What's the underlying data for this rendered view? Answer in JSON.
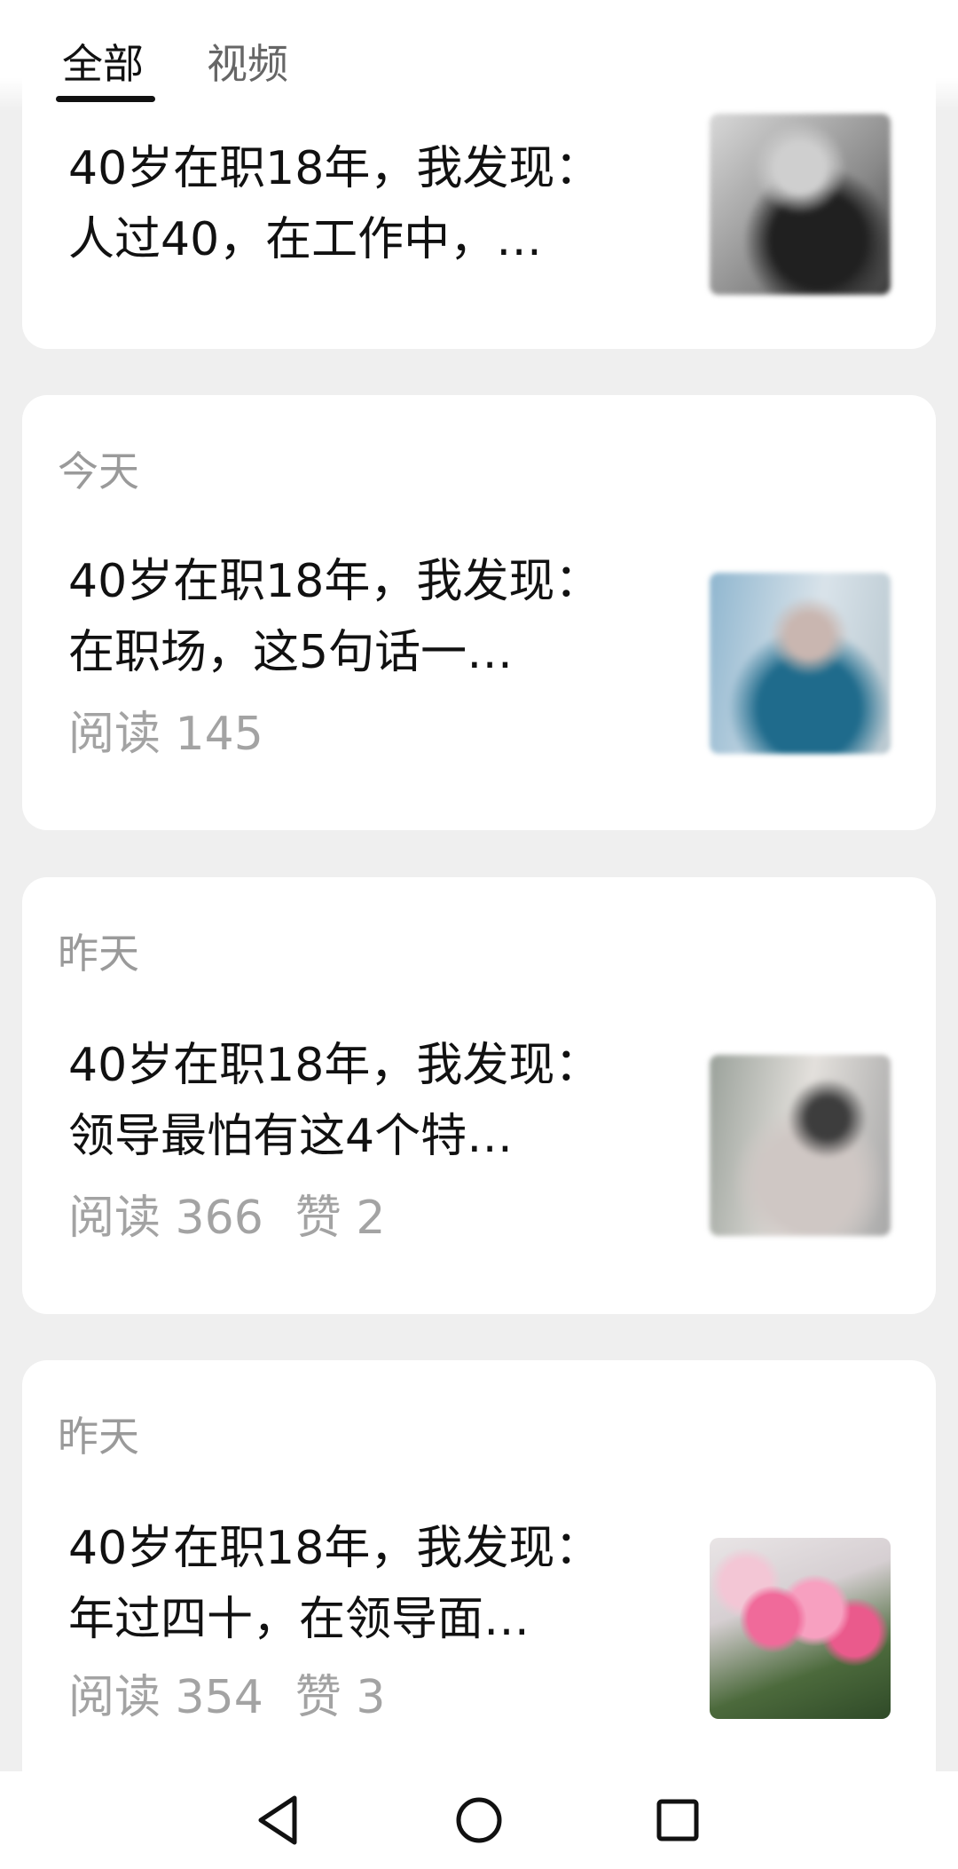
{
  "tabs": [
    {
      "label": "全部",
      "active": true
    },
    {
      "label": "视频",
      "active": false
    }
  ],
  "articles": [
    {
      "date": "",
      "title_line1": "40岁在职18年，我发现：",
      "title_line2": "人过40，在工作中，…",
      "reads": "",
      "likes": ""
    },
    {
      "date": "今天",
      "title_line1": "40岁在职18年，我发现：",
      "title_line2": "在职场，这5句话一…",
      "reads": "阅读 145",
      "likes": ""
    },
    {
      "date": "昨天",
      "title_line1": "40岁在职18年，我发现：",
      "title_line2": "领导最怕有这4个特…",
      "reads": "阅读 366",
      "likes": "赞 2"
    },
    {
      "date": "昨天",
      "title_line1": "40岁在职18年，我发现：",
      "title_line2": "年过四十，在领导面…",
      "reads": "阅读 354",
      "likes": "赞 3"
    }
  ],
  "navbar": {
    "back_icon": "back-triangle-icon",
    "home_icon": "home-circle-icon",
    "recent_icon": "recent-apps-square-icon"
  }
}
